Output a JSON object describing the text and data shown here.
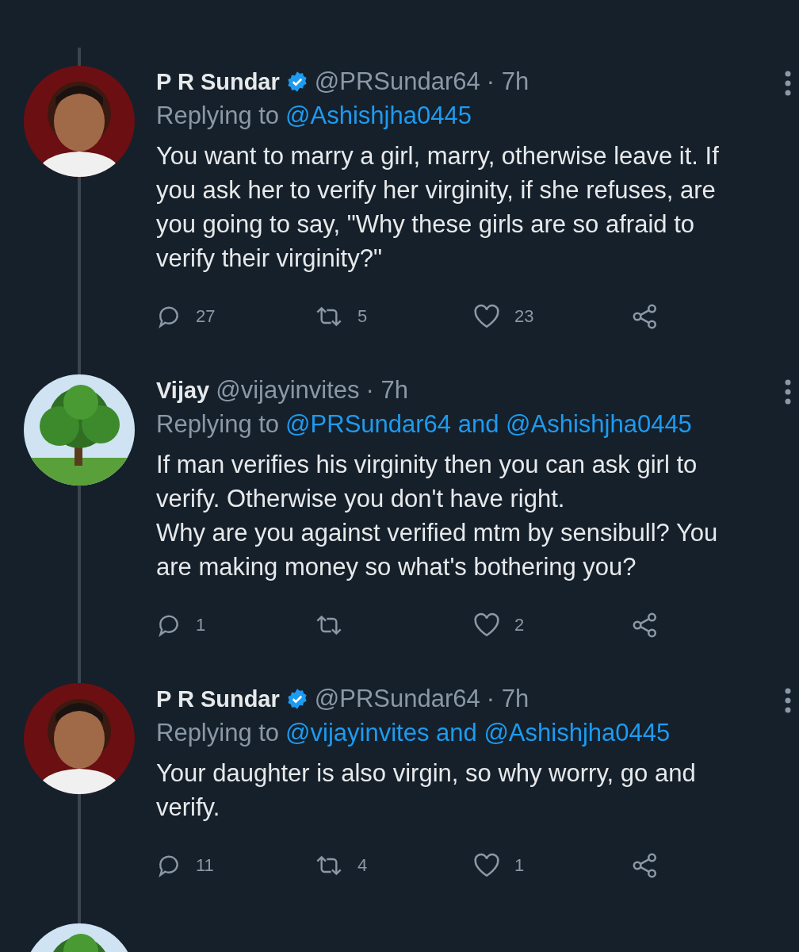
{
  "tweets": [
    {
      "avatar": {
        "kind": "person"
      },
      "name": "P R Sundar",
      "verified": true,
      "handle": "@PRSundar64",
      "time": "· 7h",
      "replying_label": "Replying to",
      "replying_to": "@Ashishjha0445",
      "text": "You want to marry a girl, marry, otherwise leave it. If you ask her to verify her virginity, if she refuses, are you going to say, \"Why these girls are so afraid to verify their virginity?\"",
      "replies": "27",
      "retweets": "5",
      "likes": "23"
    },
    {
      "avatar": {
        "kind": "tree"
      },
      "name": "Vijay",
      "verified": false,
      "handle": "@vijayinvites",
      "time": "· 7h",
      "replying_label": "Replying to",
      "replying_to": "@PRSundar64 and @Ashishjha0445",
      "text": "If man verifies his virginity then you can ask girl to verify. Otherwise you don't have right.\nWhy are you against verified mtm by sensibull? You are making money so what's bothering you?",
      "replies": "1",
      "likes": "2"
    },
    {
      "avatar": {
        "kind": "person"
      },
      "name": "P R Sundar",
      "verified": true,
      "handle": "@PRSundar64",
      "time": "· 7h",
      "replying_label": "Replying to",
      "replying_to": "@vijayinvites and @Ashishjha0445",
      "text": "Your daughter is also virgin, so why worry, go and verify.",
      "replies": "11",
      "retweets": "4",
      "likes": "1"
    }
  ],
  "next_avatar": {
    "kind": "tree"
  }
}
